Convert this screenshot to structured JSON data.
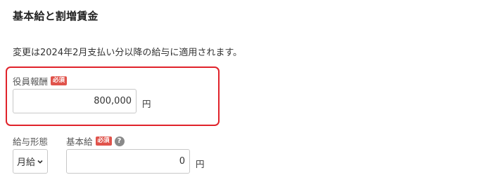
{
  "section": {
    "title": "基本給と割増賃金",
    "notice": "変更は2024年2月支払い分以降の給与に適用されます。"
  },
  "officer_pay": {
    "label": "役員報酬",
    "required_badge": "必須",
    "value": "800,000",
    "unit": "円",
    "highlight_color": "#e0222a"
  },
  "pay_type": {
    "label": "給与形態",
    "selected": "月給"
  },
  "base_pay": {
    "label": "基本給",
    "required_badge": "必須",
    "help_icon": "?",
    "value": "0",
    "unit": "円"
  }
}
